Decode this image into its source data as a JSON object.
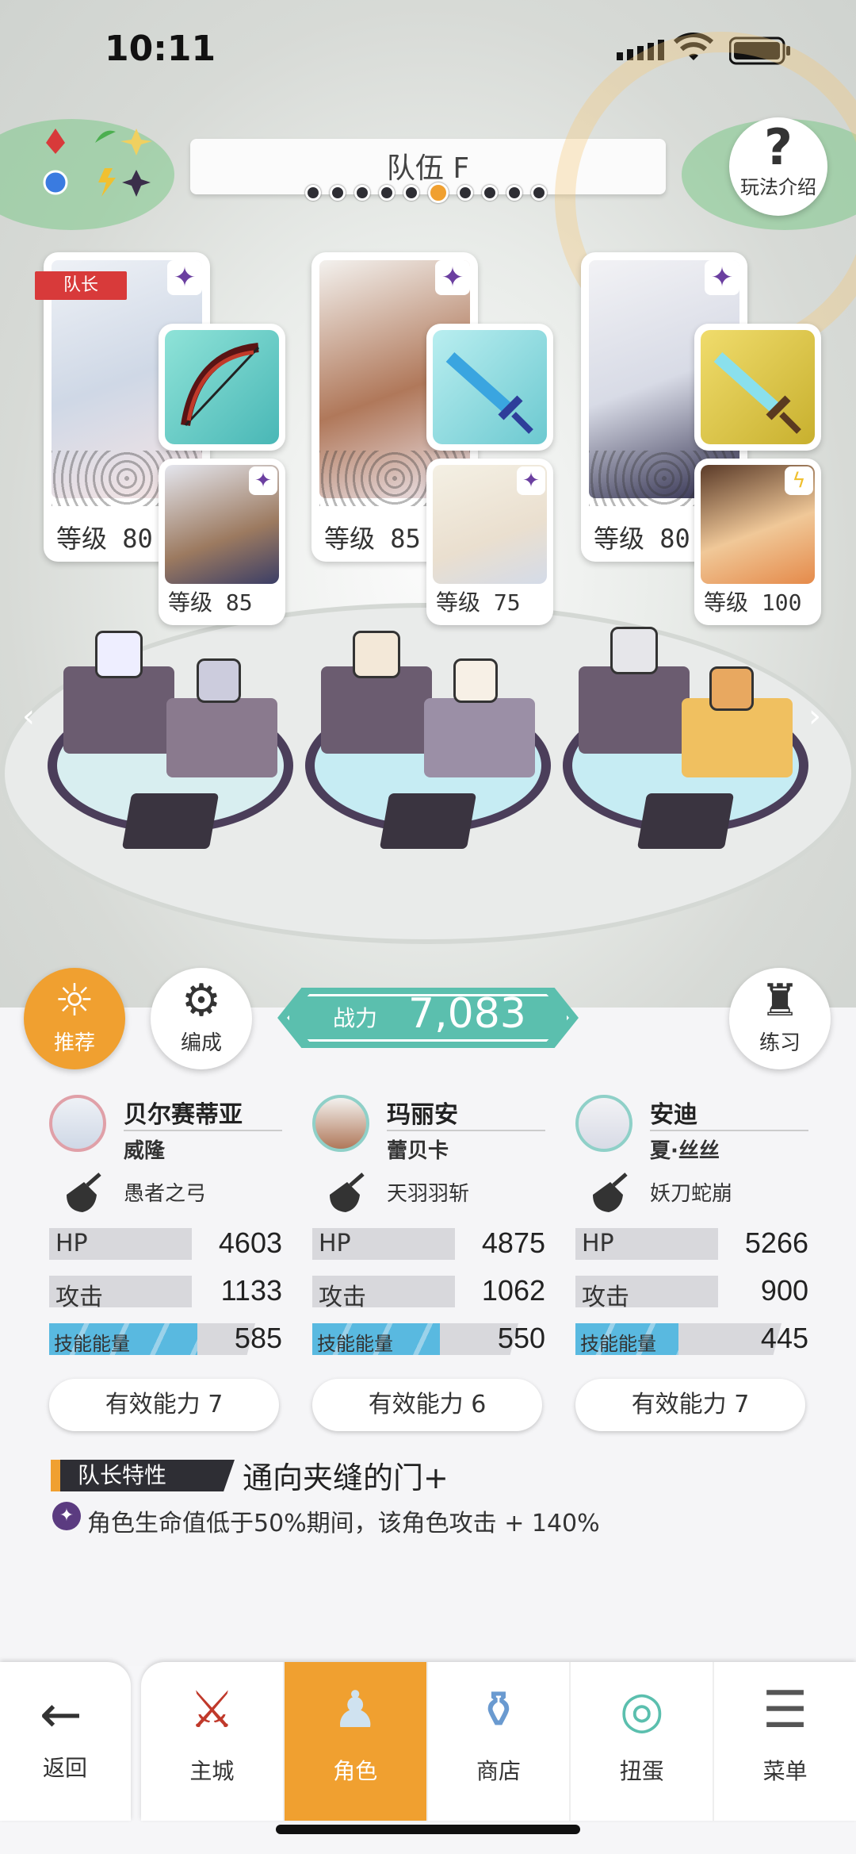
{
  "status_bar": {
    "time": "10:11"
  },
  "header": {
    "team_name": "队伍 F",
    "page_total": 10,
    "page_current_index": 5,
    "help_label": "玩法介绍"
  },
  "leader_tag": "队长",
  "party": [
    {
      "main_level": "等级 80",
      "sub_level": "等级 85",
      "rarity_icon": "star-icon",
      "sub_icon": "star-icon"
    },
    {
      "main_level": "等级 85",
      "sub_level": "等级 75",
      "rarity_icon": "star-icon",
      "sub_icon": "star-icon"
    },
    {
      "main_level": "等级 80",
      "sub_level": "等级 100",
      "rarity_icon": "star-icon",
      "sub_icon": "lightning-icon"
    }
  ],
  "actions": {
    "recommend": "推荐",
    "formation": "编成",
    "practice": "练习"
  },
  "power": {
    "label": "战力",
    "value": "7,083"
  },
  "members": [
    {
      "name": "贝尔赛蒂亚",
      "sub": "威隆",
      "weapon": "愚者之弓",
      "hp_label": "HP",
      "hp": "4603",
      "atk_label": "攻击",
      "atk": "1133",
      "energy_label": "技能能量",
      "energy": "585",
      "energy_fill": 0.72,
      "effective": "有效能力 7"
    },
    {
      "name": "玛丽安",
      "sub": "蕾贝卡",
      "weapon": "天羽羽斩",
      "hp_label": "HP",
      "hp": "4875",
      "atk_label": "攻击",
      "atk": "1062",
      "energy_label": "技能能量",
      "energy": "550",
      "energy_fill": 0.62,
      "effective": "有效能力 6"
    },
    {
      "name": "安迪",
      "sub": "夏·丝丝",
      "weapon": "妖刀蛇崩",
      "hp_label": "HP",
      "hp": "5266",
      "atk_label": "攻击",
      "atk": "900",
      "energy_label": "技能能量",
      "energy": "445",
      "energy_fill": 0.5,
      "effective": "有效能力 7"
    }
  ],
  "leader_trait": {
    "tag": "队长特性",
    "title": "通向夹缝的门+",
    "description": "角色生命值低于50%期间，该角色攻击 + 140%"
  },
  "nav": {
    "back": "返回",
    "tabs": [
      {
        "label": "主城",
        "icon": "castle-icon",
        "active": false
      },
      {
        "label": "角色",
        "icon": "character-icon",
        "active": true
      },
      {
        "label": "商店",
        "icon": "shop-icon",
        "active": false
      },
      {
        "label": "扭蛋",
        "icon": "gacha-icon",
        "active": false
      },
      {
        "label": "菜单",
        "icon": "menu-icon",
        "active": false
      }
    ]
  },
  "colors": {
    "accent": "#f0a030",
    "power": "#5bbfae",
    "energy": "#59b9e0",
    "rarity": "#6b3fa0"
  }
}
